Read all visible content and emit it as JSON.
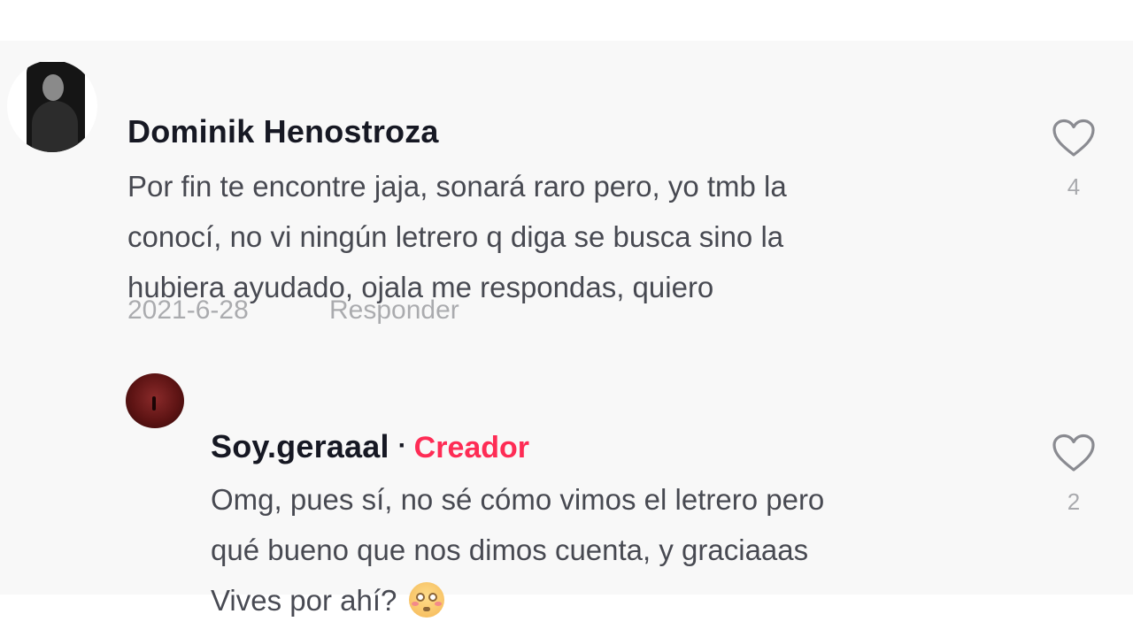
{
  "comment": {
    "username": "Dominik Henostroza",
    "text_lines": [
      "Por fin te encontre jaja, sonará raro pero, yo tmb la",
      "conocí, no vi ningún letrero q diga se busca sino la",
      "hubiera ayudado, ojala me respondas, quiero"
    ],
    "date": "2021-6-28",
    "reply_label": "Responder",
    "like_icon": "heart-outline-icon",
    "like_count": "4"
  },
  "reply": {
    "username": "Soy.geraaal",
    "separator": "·",
    "badge": "Creador",
    "badge_color": "#fe2c55",
    "text_lines": [
      "Omg, pues sí, no sé cómo vimos el letrero pero",
      "qué bueno que nos dimos cuenta, y graciaaas",
      "Vives por ahí?"
    ],
    "emoji": "flushed-face-emoji",
    "like_icon": "heart-outline-icon",
    "like_count": "2"
  },
  "colors": {
    "panel_background": "#f8f8f8",
    "text_primary": "#161823",
    "accent": "#fe2c55"
  }
}
